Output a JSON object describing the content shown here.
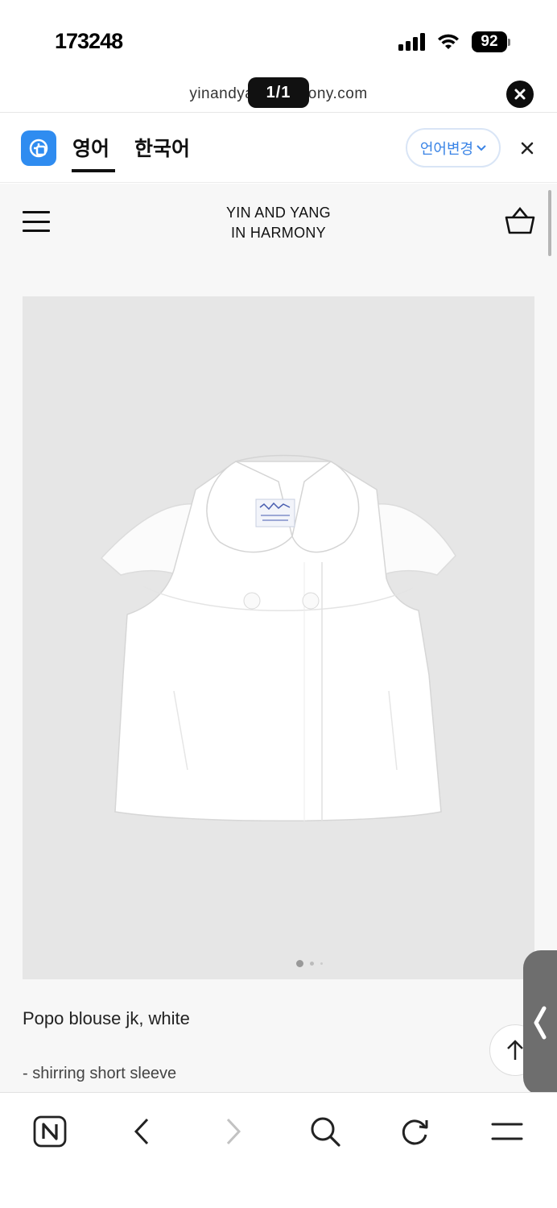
{
  "status_bar": {
    "time": "173248",
    "battery": "92",
    "icons": [
      "cellular-signal-icon",
      "wifi-icon",
      "battery-icon"
    ]
  },
  "url_bar": {
    "url": "yinandyangharmony.com",
    "page_counter": "1/1",
    "close_icon": "close-circle-icon"
  },
  "translate_bar": {
    "logo_icon": "translate-app-icon",
    "tabs": [
      {
        "label": "영어",
        "active": true
      },
      {
        "label": "한국어",
        "active": false
      }
    ],
    "change_language_label": "언어변경",
    "close_icon": "close-icon"
  },
  "site_header": {
    "brand_line1": "YIN AND YANG",
    "brand_line2": "IN HARMONY",
    "menu_icon": "hamburger-menu-icon",
    "cart_icon": "shopping-basket-icon"
  },
  "product": {
    "image": "white short-sleeve blouse jacket with round collar",
    "label_text": "YIN AND YANG IN HARMONY",
    "carousel": {
      "total": 3,
      "current": 1
    },
    "title": "Popo blouse jk, white",
    "description": "- shirring short sleeve"
  },
  "floating": {
    "scroll_top_icon": "arrow-up-icon",
    "side_tab_icon": "chevron-left-icon"
  },
  "toolbar": {
    "items": [
      "naver-home-icon",
      "back-icon",
      "forward-icon",
      "search-icon",
      "refresh-icon",
      "menu-icon"
    ]
  },
  "colors": {
    "accent_blue": "#3a84e6",
    "logo_blue": "#2f8cf0",
    "page_bg": "#f7f7f7",
    "image_bg": "#e6e6e6"
  }
}
